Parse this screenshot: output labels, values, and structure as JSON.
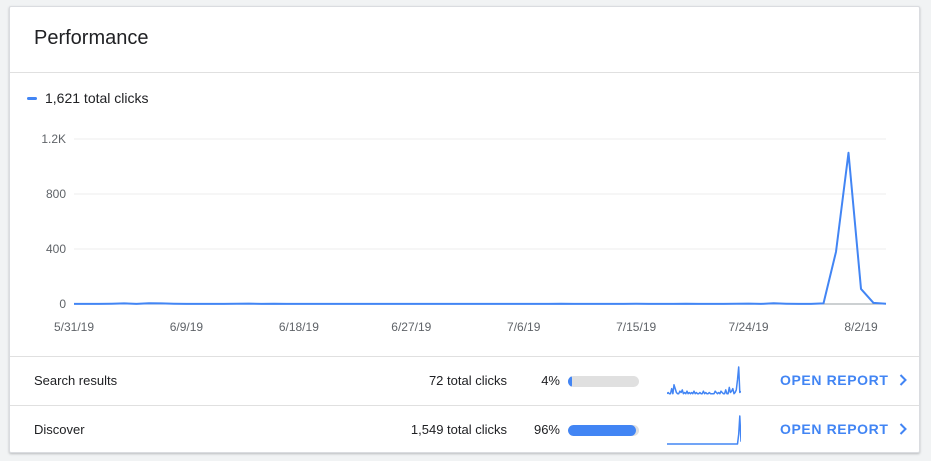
{
  "title": "Performance",
  "accent_color": "#4285f4",
  "legend": {
    "label": "1,621 total clicks"
  },
  "chart_data": {
    "type": "line",
    "series": [
      {
        "name": "1,621 total clicks",
        "x": [
          "5/31/19",
          "6/1/19",
          "6/2/19",
          "6/3/19",
          "6/4/19",
          "6/5/19",
          "6/6/19",
          "6/7/19",
          "6/8/19",
          "6/9/19",
          "6/10/19",
          "6/11/19",
          "6/12/19",
          "6/13/19",
          "6/14/19",
          "6/15/19",
          "6/16/19",
          "6/17/19",
          "6/18/19",
          "6/19/19",
          "6/20/19",
          "6/21/19",
          "6/22/19",
          "6/23/19",
          "6/24/19",
          "6/25/19",
          "6/26/19",
          "6/27/19",
          "6/28/19",
          "6/29/19",
          "6/30/19",
          "7/1/19",
          "7/2/19",
          "7/3/19",
          "7/4/19",
          "7/5/19",
          "7/6/19",
          "7/7/19",
          "7/8/19",
          "7/9/19",
          "7/10/19",
          "7/11/19",
          "7/12/19",
          "7/13/19",
          "7/14/19",
          "7/15/19",
          "7/16/19",
          "7/17/19",
          "7/18/19",
          "7/19/19",
          "7/20/19",
          "7/21/19",
          "7/22/19",
          "7/23/19",
          "7/24/19",
          "7/25/19",
          "7/26/19",
          "7/27/19",
          "7/28/19",
          "7/29/19",
          "7/30/19",
          "7/31/19",
          "8/1/19",
          "8/2/19",
          "8/3/19",
          "8/4/19"
        ],
        "values": [
          1,
          1,
          1,
          2,
          4,
          1,
          6,
          4,
          2,
          1,
          1,
          1,
          1,
          2,
          3,
          1,
          2,
          1,
          1,
          1,
          1,
          1,
          1,
          1,
          1,
          1,
          1,
          1,
          1,
          1,
          1,
          1,
          1,
          1,
          1,
          1,
          1,
          1,
          1,
          2,
          1,
          1,
          1,
          1,
          1,
          2,
          1,
          1,
          1,
          2,
          1,
          1,
          1,
          2,
          3,
          1,
          5,
          2,
          1,
          1,
          4,
          380,
          1100,
          110,
          8,
          2
        ]
      }
    ],
    "x_ticks": [
      "5/31/19",
      "6/9/19",
      "6/18/19",
      "6/27/19",
      "7/6/19",
      "7/15/19",
      "7/24/19",
      "8/2/19"
    ],
    "y_ticks": [
      0,
      400,
      800,
      1200
    ],
    "y_tick_labels": [
      "0",
      "400",
      "800",
      "1.2K"
    ],
    "ylim": [
      0,
      1200
    ],
    "grid": true,
    "legend_position": "top-left"
  },
  "rows": [
    {
      "label": "Search results",
      "clicks": "72 total clicks",
      "percent_label": "4%",
      "percent": 4,
      "action": "OPEN REPORT",
      "sparkline": [
        1,
        2,
        1,
        1,
        5,
        1,
        8,
        5,
        2,
        1,
        1,
        3,
        2,
        4,
        1,
        2,
        1,
        3,
        1,
        2,
        1,
        2,
        1,
        3,
        1,
        2,
        1,
        1,
        2,
        1,
        1,
        3,
        1,
        2,
        1,
        1,
        2,
        1,
        1,
        1,
        1,
        3,
        2,
        1,
        2,
        1,
        3,
        2,
        1,
        1,
        4,
        1,
        1,
        6,
        2,
        3,
        5,
        1,
        2,
        4,
        12,
        22,
        2,
        3
      ]
    },
    {
      "label": "Discover",
      "clicks": "1,549 total clicks",
      "percent_label": "96%",
      "percent": 96,
      "action": "OPEN REPORT",
      "sparkline": [
        0,
        0,
        0,
        0,
        0,
        0,
        0,
        0,
        0,
        0,
        0,
        0,
        0,
        0,
        0,
        0,
        0,
        0,
        0,
        0,
        0,
        0,
        0,
        0,
        0,
        0,
        0,
        0,
        0,
        0,
        0,
        0,
        0,
        0,
        0,
        0,
        0,
        0,
        0,
        0,
        0,
        0,
        0,
        0,
        0,
        0,
        0,
        0,
        0,
        0,
        0,
        0,
        0,
        0,
        0,
        0,
        0,
        0,
        0,
        0,
        0,
        380,
        1100,
        90
      ]
    }
  ]
}
